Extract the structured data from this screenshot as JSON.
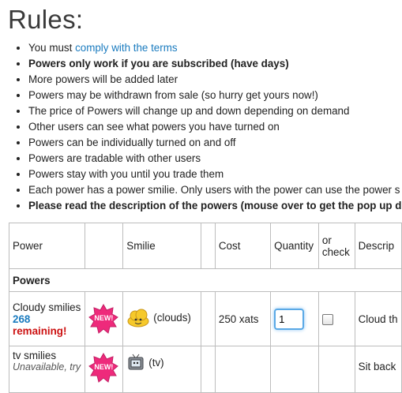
{
  "page": {
    "title": "Rules:"
  },
  "rules": {
    "items": [
      {
        "prefix": "You must ",
        "link": "comply with the terms"
      },
      {
        "text": "Powers only work if you are subscribed (have days)"
      },
      {
        "text": "More powers will be added later"
      },
      {
        "text": "Powers may be withdrawn from sale (so hurry get yours now!)"
      },
      {
        "text": "The price of Powers will change up and down depending on demand"
      },
      {
        "text": "Other users can see what powers you have turned on"
      },
      {
        "text": "Powers can be individually turned on and off"
      },
      {
        "text": "Powers are tradable with other users"
      },
      {
        "text": "Powers stay with you until you trade them"
      },
      {
        "text": "Each power has a power smilie. Only users with the power can use the power s"
      },
      {
        "text": "Please read the description of the powers (mouse over to get the pop up desc"
      }
    ]
  },
  "table": {
    "headers": {
      "power": "Power",
      "smilie": "Smilie",
      "cost": "Cost",
      "quantity": "Quantity",
      "check_line1": "or",
      "check_line2": "check",
      "description": "Descrip"
    },
    "section_label": "Powers",
    "rows": [
      {
        "name": "Cloudy smilies",
        "remaining_count": "268",
        "remaining_label": "remaining!",
        "badge": "NEW!",
        "smilie_icon": "cloud-smilie-icon",
        "smilie_code": "(clouds)",
        "cost": "250 xats",
        "quantity": "1",
        "description": "Cloud th"
      },
      {
        "name": "tv smilies",
        "status": "Unavailable, try",
        "badge": "NEW!",
        "smilie_icon": "tv-smilie-icon",
        "smilie_code": "(tv)",
        "description": "Sit back"
      }
    ]
  },
  "colors": {
    "link": "#1a7bbf",
    "remaining": "#cc1111",
    "badge": "#ee2a7b"
  }
}
